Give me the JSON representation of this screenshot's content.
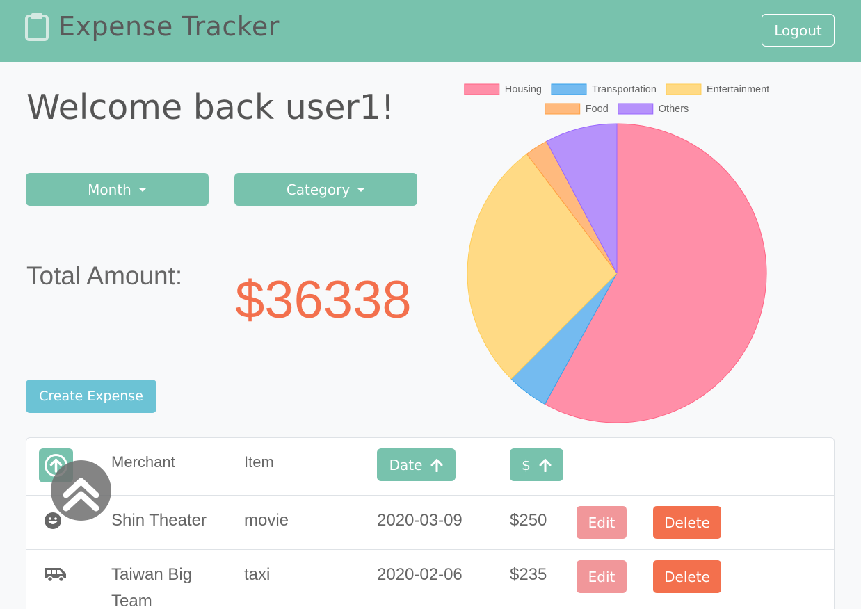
{
  "navbar": {
    "brand_title": "Expense Tracker",
    "brand_icon": "clipboard-icon",
    "logout_label": "Logout"
  },
  "welcome_text": "Welcome back user1!",
  "filters": {
    "month_label": "Month",
    "category_label": "Category"
  },
  "total": {
    "label": "Total Amount:",
    "value": "$36338"
  },
  "create_label": "Create Expense",
  "colors": {
    "primary": "#78c2ad",
    "info": "#6cc3d5",
    "danger": "#f3704d",
    "edit": "#f1979a"
  },
  "chart_data": {
    "type": "pie",
    "legend_position": "top",
    "slices": [
      {
        "label": "Housing",
        "value": 58.0,
        "color": "#ff8fa8",
        "border": "#ff6384"
      },
      {
        "label": "Transportation",
        "value": 4.5,
        "color": "#74bbf0",
        "border": "#36a2eb"
      },
      {
        "label": "Entertainment",
        "value": 27.2,
        "color": "#ffda85",
        "border": "#ffcd56"
      },
      {
        "label": "Food",
        "value": 2.5,
        "color": "#ffba7e",
        "border": "#ff9f40"
      },
      {
        "label": "Others",
        "value": 7.8,
        "color": "#b692fb",
        "border": "#9966ff"
      }
    ]
  },
  "table": {
    "sort_icon": "arrow-up-circle-icon",
    "headers": {
      "merchant": "Merchant",
      "item": "Item",
      "date": "Date",
      "amount": "$"
    },
    "rows": [
      {
        "icon": "smile-icon",
        "merchant": "Shin Theater",
        "item": "movie",
        "date": "2020-03-09",
        "amount": "$250",
        "edit": "Edit",
        "delete": "Delete"
      },
      {
        "icon": "shuttle-van-icon",
        "merchant_line1": "Taiwan Big",
        "merchant_line2": "Team",
        "item": "taxi",
        "date": "2020-02-06",
        "amount": "$235",
        "edit": "Edit",
        "delete": "Delete"
      }
    ]
  },
  "scroll_top_icon": "chevrons-up-icon"
}
